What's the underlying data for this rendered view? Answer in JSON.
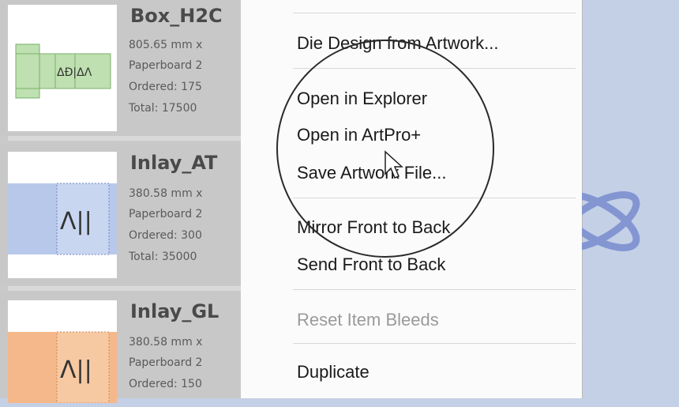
{
  "items": [
    {
      "name": "Box_H2C",
      "lines": [
        "805.65 mm x",
        "Paperboard 2",
        "Ordered: 175",
        "Total: 17500"
      ],
      "color": "#b9dcaa",
      "art": "ΔĐ|ΔΛ"
    },
    {
      "name": "Inlay_AT",
      "lines": [
        "380.58 mm x",
        "Paperboard 2",
        "Ordered: 300",
        "Total: 35000"
      ],
      "color": "#b9c9ea",
      "art": "Λ||"
    },
    {
      "name": "Inlay_GL",
      "lines": [
        "380.58 mm x",
        "Paperboard 2",
        "Ordered: 150"
      ],
      "color": "#f5b98c",
      "art": "Λ||"
    }
  ],
  "menu": {
    "die_design": "Die Design from Artwork...",
    "open_explorer": "Open in Explorer",
    "open_artpro": "Open in ArtPro+",
    "save_artwork": "Save Artwork File...",
    "mirror": "Mirror Front to Back",
    "send_front": "Send Front to Back",
    "reset_bleeds": "Reset Item Bleeds",
    "duplicate": "Duplicate"
  },
  "colors": {
    "accent_blue": "#7f92cf",
    "background": "#c4d0e6"
  }
}
